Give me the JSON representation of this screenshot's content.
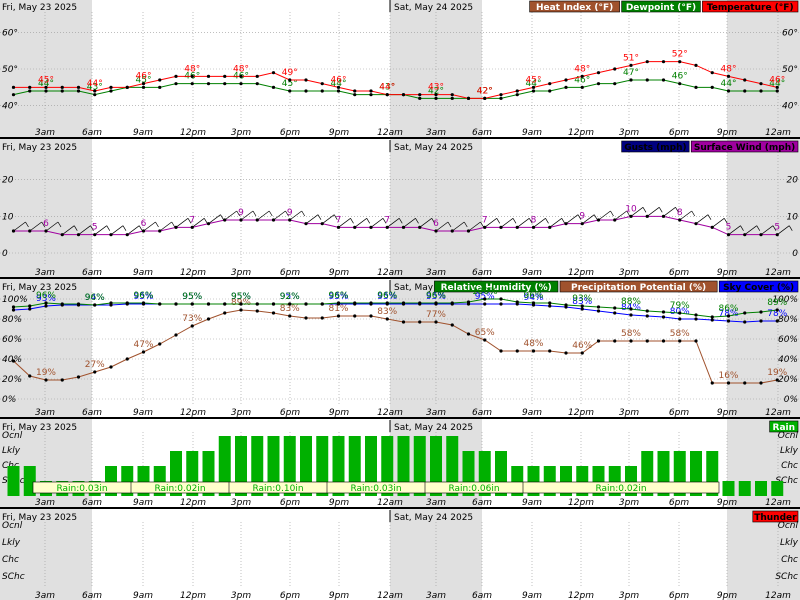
{
  "colors": {
    "temperature": "#ff0000",
    "dewpoint": "#008000",
    "heat_index": "#a0522d",
    "gusts": "#000080",
    "surface_wind": "#a000a0",
    "relative_humidity": "#008000",
    "precip_potential": "#a0522d",
    "sky_cover": "#0000ff",
    "rain": "#00b000",
    "thunder": "#ff0000",
    "night_shade": "#e0e0e0"
  },
  "dates": {
    "day1": "Fri, May 23 2025",
    "day2": "Sat, May 24 2025"
  },
  "time_labels": [
    "3am",
    "6am",
    "9am",
    "12pm",
    "3pm",
    "6pm",
    "9pm",
    "12am",
    "3am",
    "6am",
    "9am",
    "12pm",
    "3pm",
    "6pm",
    "9pm",
    "12am"
  ],
  "chart_data": [
    {
      "type": "line",
      "legend": [
        "Heat Index (°F)",
        "Dewpoint (°F)",
        "Temperature (°F)"
      ],
      "ylim": [
        35,
        65
      ],
      "yticks": [
        "60°",
        "50°",
        "40°"
      ],
      "hours": [
        1,
        2,
        3,
        4,
        5,
        6,
        7,
        8,
        9,
        10,
        11,
        12,
        13,
        14,
        15,
        16,
        17,
        18,
        19,
        20,
        21,
        22,
        23,
        24,
        25,
        26,
        27,
        28,
        29,
        30,
        31,
        32,
        33,
        34,
        35,
        36,
        37,
        38,
        39,
        40,
        41,
        42,
        43,
        44,
        45,
        46,
        47,
        48
      ],
      "series": [
        {
          "name": "Temperature (°F)",
          "values": [
            45,
            45,
            45,
            45,
            45,
            44,
            45,
            45,
            46,
            47,
            48,
            48,
            48,
            48,
            48,
            48,
            49,
            47,
            47,
            46,
            45,
            44,
            44,
            43,
            43,
            43,
            43,
            43,
            42,
            42,
            43,
            44,
            45,
            46,
            47,
            48,
            49,
            50,
            51,
            52,
            52,
            52,
            51,
            49,
            48,
            47,
            46,
            45
          ],
          "labels": [
            [
              3,
              "45°"
            ],
            [
              6,
              "44°"
            ],
            [
              9,
              "46°"
            ],
            [
              12,
              "48°"
            ],
            [
              15,
              "48°"
            ],
            [
              18,
              "49°"
            ],
            [
              21,
              "46°"
            ],
            [
              24,
              "44°"
            ],
            [
              27,
              "43°"
            ],
            [
              30,
              "42°"
            ],
            [
              33,
              "45°"
            ],
            [
              36,
              "48°"
            ],
            [
              39,
              "51°"
            ],
            [
              42,
              "52°"
            ],
            [
              45,
              "48°"
            ],
            [
              48,
              "46°"
            ]
          ]
        },
        {
          "name": "Dewpoint (°F)",
          "values": [
            43,
            44,
            44,
            44,
            44,
            43,
            44,
            45,
            45,
            45,
            46,
            46,
            46,
            46,
            46,
            46,
            45,
            44,
            44,
            44,
            44,
            43,
            43,
            43,
            43,
            42,
            42,
            42,
            42,
            42,
            42,
            43,
            44,
            44,
            45,
            45,
            46,
            46,
            47,
            47,
            47,
            46,
            45,
            45,
            44,
            44,
            44,
            44
          ],
          "labels": [
            [
              3,
              "44°"
            ],
            [
              6,
              "43°"
            ],
            [
              9,
              "45°"
            ],
            [
              12,
              "46°"
            ],
            [
              15,
              "46°"
            ],
            [
              18,
              "45°"
            ],
            [
              21,
              "44°"
            ],
            [
              24,
              "43°"
            ],
            [
              27,
              "42°"
            ],
            [
              30,
              "42°"
            ],
            [
              33,
              "44°"
            ],
            [
              36,
              "46°"
            ],
            [
              39,
              "47°"
            ],
            [
              42,
              "46°"
            ],
            [
              45,
              "44°"
            ],
            [
              48,
              "44°"
            ]
          ]
        },
        {
          "name": "Heat Index (°F)",
          "values": []
        }
      ]
    },
    {
      "type": "line",
      "legend": [
        "Gusts (mph)",
        "Surface Wind (mph)"
      ],
      "ylim": [
        -3,
        27
      ],
      "yticks": [
        "20",
        "10",
        "0"
      ],
      "series": [
        {
          "name": "Surface Wind (mph)",
          "values": [
            6,
            6,
            6,
            5,
            5,
            5,
            5,
            5,
            6,
            6,
            7,
            7,
            8,
            9,
            9,
            9,
            9,
            9,
            8,
            8,
            7,
            7,
            7,
            7,
            7,
            7,
            6,
            6,
            6,
            7,
            7,
            7,
            7,
            7,
            8,
            8,
            9,
            9,
            10,
            10,
            10,
            9,
            8,
            7,
            5,
            5,
            5,
            5
          ],
          "labels": [
            [
              3,
              "6"
            ],
            [
              6,
              "5"
            ],
            [
              9,
              "6"
            ],
            [
              12,
              "7"
            ],
            [
              15,
              "9"
            ],
            [
              18,
              "9"
            ],
            [
              21,
              "7"
            ],
            [
              24,
              "7"
            ],
            [
              27,
              "6"
            ],
            [
              30,
              "7"
            ],
            [
              33,
              "8"
            ],
            [
              36,
              "9"
            ],
            [
              39,
              "10"
            ],
            [
              42,
              "8"
            ],
            [
              45,
              "5"
            ],
            [
              48,
              "5"
            ]
          ]
        },
        {
          "name": "Gusts (mph)",
          "values": []
        }
      ]
    },
    {
      "type": "line",
      "legend": [
        "Relative Humidity (%)",
        "Precipitation Potential (%)",
        "Sky Cover (%)"
      ],
      "ylim": [
        -5,
        105
      ],
      "yticks": [
        "100%",
        "80%",
        "60%",
        "40%",
        "20%",
        "0%"
      ],
      "series": [
        {
          "name": "Relative Humidity (%)",
          "values": [
            92,
            93,
            96,
            95,
            95,
            94,
            96,
            96,
            96,
            95,
            95,
            95,
            95,
            95,
            95,
            95,
            95,
            95,
            95,
            95,
            96,
            96,
            96,
            96,
            96,
            96,
            96,
            96,
            97,
            100,
            100,
            97,
            96,
            96,
            94,
            93,
            92,
            91,
            90,
            88,
            87,
            86,
            84,
            82,
            83,
            86,
            87,
            89
          ],
          "labels": [
            [
              3,
              "96%"
            ],
            [
              6,
              "96%"
            ],
            [
              9,
              "96%"
            ],
            [
              12,
              "95%"
            ],
            [
              15,
              "95%"
            ],
            [
              18,
              "92%"
            ],
            [
              21,
              "96%"
            ],
            [
              24,
              "96%"
            ],
            [
              27,
              "96%"
            ],
            [
              30,
              "100%"
            ],
            [
              33,
              "96%"
            ],
            [
              36,
              "93%"
            ],
            [
              39,
              "88%"
            ],
            [
              42,
              "79%"
            ],
            [
              45,
              "86%"
            ],
            [
              48,
              "89%"
            ]
          ]
        },
        {
          "name": "Precipitation Potential (%)",
          "values": [
            38,
            23,
            19,
            19,
            22,
            27,
            32,
            40,
            47,
            55,
            64,
            73,
            80,
            86,
            89,
            88,
            86,
            83,
            81,
            81,
            83,
            83,
            83,
            80,
            77,
            77,
            77,
            74,
            65,
            59,
            48,
            48,
            48,
            48,
            46,
            46,
            58,
            58,
            58,
            58,
            58,
            58,
            58,
            16,
            16,
            16,
            16,
            19
          ],
          "labels": [
            [
              3,
              "19%"
            ],
            [
              6,
              "27%"
            ],
            [
              9,
              "47%"
            ],
            [
              12,
              "73%"
            ],
            [
              15,
              "89%"
            ],
            [
              18,
              "83%"
            ],
            [
              21,
              "81%"
            ],
            [
              24,
              "83%"
            ],
            [
              27,
              "77%"
            ],
            [
              30,
              "65%"
            ],
            [
              33,
              "48%"
            ],
            [
              36,
              "46%"
            ],
            [
              39,
              "58%"
            ],
            [
              42,
              "58%"
            ],
            [
              45,
              "16%"
            ],
            [
              48,
              "19%"
            ]
          ]
        },
        {
          "name": "Sky Cover (%)",
          "values": [
            89,
            90,
            93,
            94,
            94,
            94,
            94,
            95,
            95,
            95,
            95,
            95,
            95,
            95,
            95,
            95,
            95,
            95,
            95,
            95,
            95,
            95,
            95,
            95,
            95,
            95,
            95,
            95,
            95,
            95,
            95,
            95,
            94,
            93,
            92,
            90,
            88,
            86,
            84,
            83,
            82,
            80,
            80,
            79,
            78,
            77,
            78,
            78
          ],
          "labels": [
            [
              3,
              "93%"
            ],
            [
              6,
              "94%"
            ],
            [
              9,
              "95%"
            ],
            [
              12,
              "95%"
            ],
            [
              15,
              "95%"
            ],
            [
              18,
              "95%"
            ],
            [
              21,
              "95%"
            ],
            [
              24,
              "95%"
            ],
            [
              27,
              "95%"
            ],
            [
              30,
              "95%"
            ],
            [
              33,
              "94%"
            ],
            [
              36,
              "83%"
            ],
            [
              39,
              "84%"
            ],
            [
              42,
              "80%"
            ],
            [
              45,
              "78%"
            ],
            [
              48,
              "78%"
            ]
          ]
        }
      ]
    },
    {
      "type": "bar",
      "legend": [
        "Rain"
      ],
      "levels": [
        "Ocnl",
        "Lkly",
        "Chc",
        "SChc"
      ],
      "values": [
        2,
        2,
        1,
        1,
        1,
        1,
        2,
        2,
        2,
        2,
        3,
        3,
        3,
        4,
        4,
        4,
        4,
        4,
        4,
        4,
        4,
        4,
        4,
        4,
        4,
        4,
        4,
        4,
        3,
        3,
        3,
        2,
        2,
        2,
        2,
        2,
        2,
        2,
        2,
        3,
        3,
        3,
        3,
        3,
        1,
        1,
        1,
        1
      ],
      "amounts": [
        "Rain:0.03in",
        "Rain:0.02in",
        "Rain:0.10in",
        "Rain:0.03in",
        "Rain:0.06in",
        "Rain:0.02in"
      ]
    },
    {
      "type": "bar",
      "legend": [
        "Thunder"
      ],
      "levels": [
        "Ocnl",
        "Lkly",
        "Chc",
        "SChc"
      ],
      "values": []
    }
  ]
}
